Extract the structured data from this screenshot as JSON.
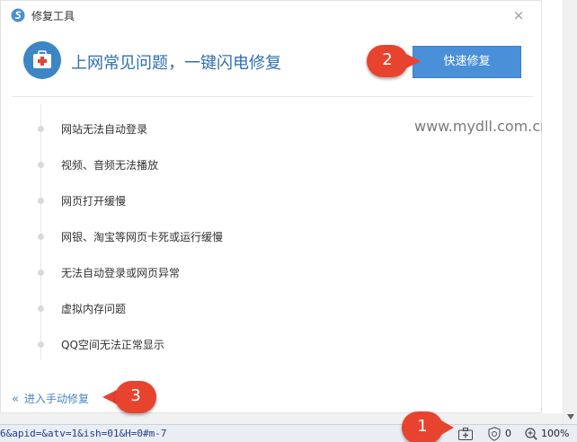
{
  "window": {
    "title": "修复工具",
    "close_label": "×"
  },
  "hero": {
    "headline": "上网常见问题，一键闪电修复",
    "fix_button": "快速修复"
  },
  "watermark": "www.mydll.com.cn",
  "issues": [
    "网站无法自动登录",
    "视频、音频无法播放",
    "网页打开缓慢",
    "网银、淘宝等网页卡死或运行缓慢",
    "无法自动登录或网页异常",
    "虚拟内存问题",
    "QQ空间无法正常显示"
  ],
  "manual": {
    "chevron": "«",
    "label": "进入手动修复"
  },
  "statusbar": {
    "url": "6&apid=&atv=1&ish=01&H=0#m-7",
    "shield_count": "0",
    "zoom": "100%"
  },
  "markers": [
    "1",
    "2",
    "3"
  ],
  "colors": {
    "accent": "#4a90d9",
    "marker": "#e8432f",
    "headline": "#2e6fb2"
  }
}
